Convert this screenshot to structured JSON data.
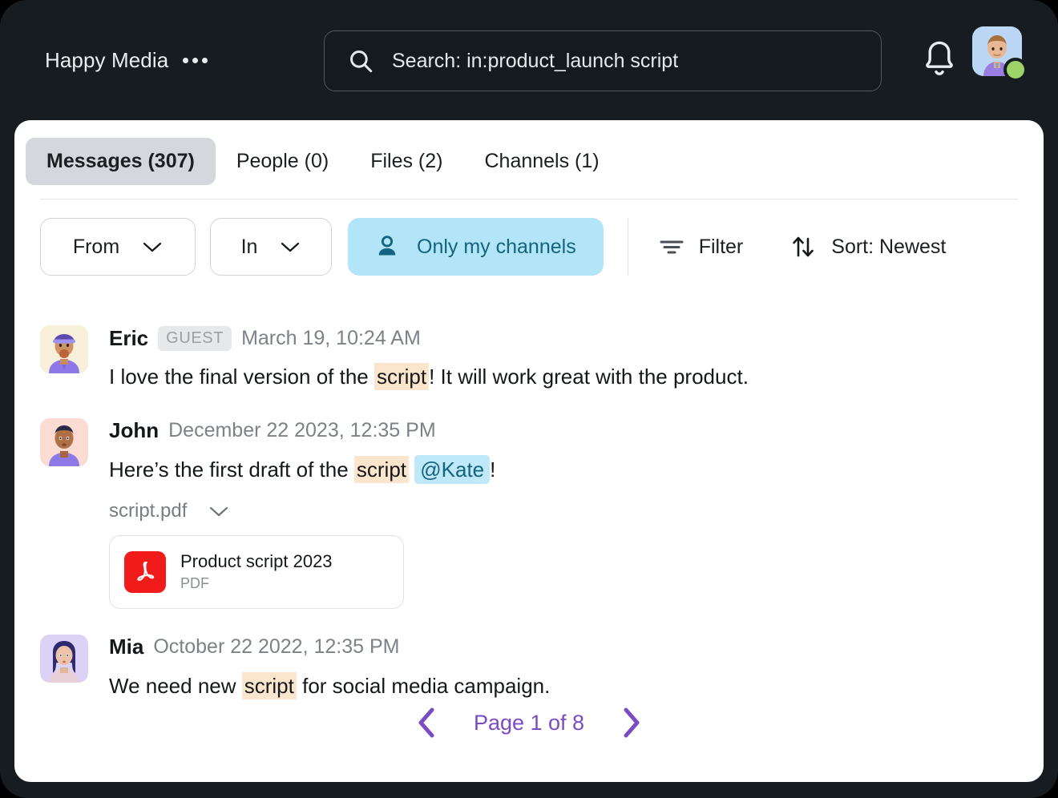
{
  "header": {
    "brand": "Happy Media",
    "menu_icon": "ellipsis-icon",
    "search": {
      "icon": "search-icon",
      "value": "Search: in:product_launch script"
    },
    "notifications_icon": "bell-icon",
    "avatar_icon": "user-avatar",
    "presence": "online"
  },
  "tabs": [
    {
      "label": "Messages (307)",
      "active": true
    },
    {
      "label": "People (0)",
      "active": false
    },
    {
      "label": "Files (2)",
      "active": false
    },
    {
      "label": "Channels (1)",
      "active": false
    }
  ],
  "filters": {
    "from_label": "From",
    "in_label": "In",
    "only_my_channels": "Only my channels",
    "filter_label": "Filter",
    "sort_label": "Sort: Newest",
    "chevron_icon": "chevron-down-icon",
    "person_icon": "person-icon",
    "filter_icon": "filter-icon",
    "sort_icon": "sort-arrows-icon"
  },
  "messages": [
    {
      "author": "Eric",
      "badge": "GUEST",
      "time": "March 19, 10:24 AM",
      "text_before": "I love the final version of the ",
      "highlight": "script",
      "text_after": "! It will work great with the product."
    },
    {
      "author": "John",
      "time": "December 22 2023, 12:35 PM",
      "text_before": "Here’s the first draft of the ",
      "highlight": "script",
      "mention": "@Kate",
      "text_after": "!",
      "attachment_toggle": "script.pdf",
      "attachment": {
        "title": "Product script 2023",
        "type": "PDF",
        "icon": "pdf-icon"
      }
    },
    {
      "author": "Mia",
      "time": "October 22 2022, 12:35 PM",
      "text_before": "We need new ",
      "highlight": "script",
      "text_after": " for social media campaign."
    }
  ],
  "pagination": {
    "prev_icon": "chevron-left-icon",
    "label": "Page 1 of 8",
    "next_icon": "chevron-right-icon"
  },
  "colors": {
    "frame": "#161c20",
    "accent_blue": "#b3e5f8",
    "highlight": "#fbe5cd",
    "pagination": "#7b4bc4",
    "presence": "#9ed36a",
    "pdf_red": "#f21b1b"
  }
}
